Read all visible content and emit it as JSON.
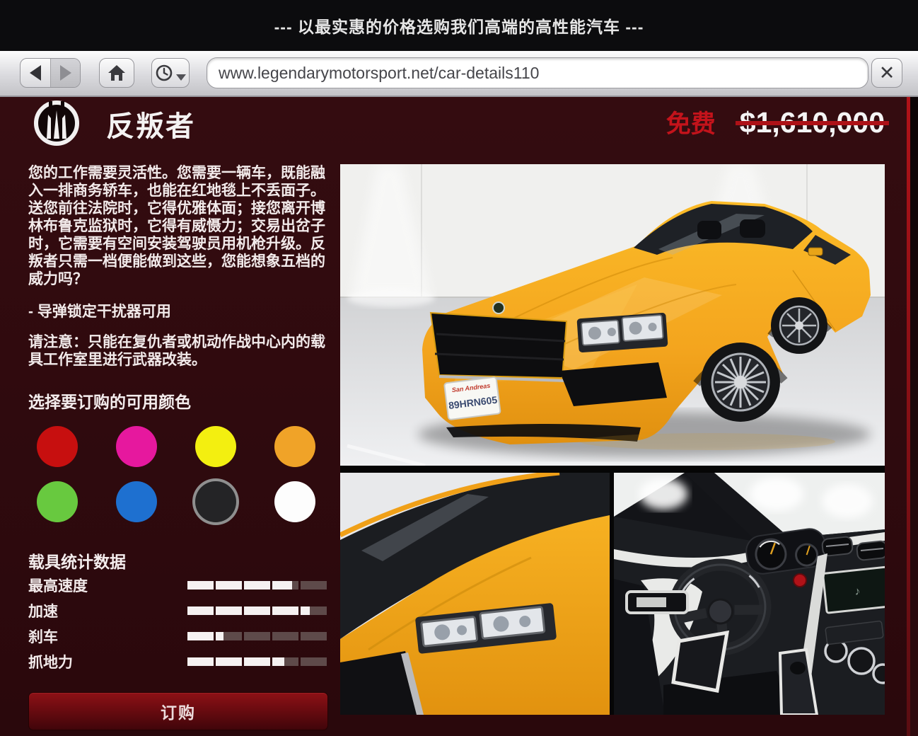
{
  "tagline": "--- 以最实惠的价格选购我们高端的高性能汽车 ---",
  "browser": {
    "url": "www.legendarymotorsport.net/car-details110",
    "icons": {
      "back": "left-triangle",
      "forward": "right-triangle",
      "home": "house",
      "history": "clock-with-caret",
      "close_glyph": "✕"
    }
  },
  "page": {
    "brand_logo": "ubermacht-crown-emblem",
    "title": "反叛者",
    "price_free": "免费",
    "price_original": "$1,610,000",
    "description": "您的工作需要灵活性。您需要一辆车，既能融入一排商务轿车，也能在红地毯上不丢面子。送您前往法院时，它得优雅体面；接您离开博林布鲁克监狱时，它得有威慑力；交易出岔子时，它需要有空间安装驾驶员用机枪升级。反叛者只需一档便能做到这些，您能想象五档的威力吗？",
    "feature_note": "- 导弹锁定干扰器可用",
    "warning_note": "请注意：只能在复仇者或机动作战中心内的载具工作室里进行武器改装。",
    "color_section_title": "选择要订购的可用颜色",
    "colors": [
      {
        "name": "red",
        "hex": "#c70f0f",
        "selected": false
      },
      {
        "name": "magenta",
        "hex": "#e6189e",
        "selected": false
      },
      {
        "name": "yellow",
        "hex": "#f3ef10",
        "selected": false
      },
      {
        "name": "orange",
        "hex": "#f0a328",
        "selected": false
      },
      {
        "name": "green",
        "hex": "#68c93f",
        "selected": false
      },
      {
        "name": "blue",
        "hex": "#1e70d0",
        "selected": false
      },
      {
        "name": "black",
        "hex": "#242426",
        "selected": true
      },
      {
        "name": "white",
        "hex": "#fdfdfd",
        "selected": false
      }
    ],
    "stats_title": "载具统计数据",
    "stats_segments": 5,
    "stats": [
      {
        "label": "最高速度",
        "value": 0.75
      },
      {
        "label": "加速",
        "value": 0.87
      },
      {
        "label": "刹车",
        "value": 0.26
      },
      {
        "label": "抓地力",
        "value": 0.69
      }
    ],
    "order_button": "订购",
    "license_plate": {
      "state": "San Andreas",
      "number": "89HRN605"
    }
  },
  "theme": {
    "accent_red": "#c3131b",
    "strike_red": "#ae1117",
    "page_bg": "#2e0a0e",
    "bar_unfilled": "#5e4a4a",
    "bar_filled": "#f5f1f1",
    "car_yellow": "#f4a51e"
  }
}
